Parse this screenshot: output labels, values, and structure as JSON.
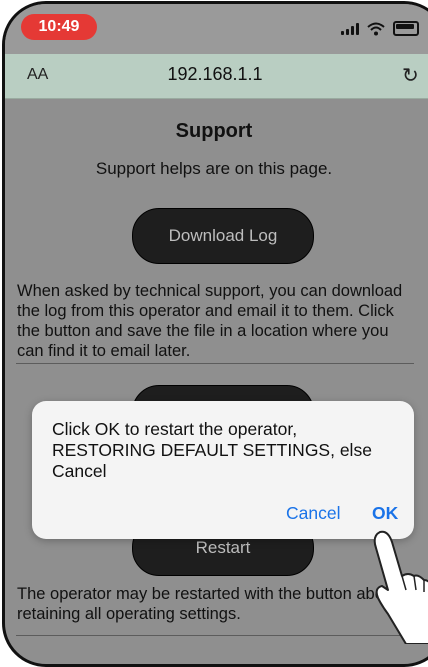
{
  "status_bar": {
    "time": "10:49",
    "signal_icon": "signal-icon",
    "wifi_icon": "wifi-icon",
    "battery_icon": "battery-icon"
  },
  "address_bar": {
    "text_size_label": "AA",
    "url": "192.168.1.1",
    "reload_icon": "reload-icon"
  },
  "page": {
    "title": "Support",
    "subtitle": "Support helps are on this page.",
    "download_button": "Download Log",
    "download_text": "When asked by technical support, you can download the log from this operator and email it to them. Click the button and save the file in a location where you can find it to email later.",
    "restart_button": "Restart",
    "restart_text": "The operator may be restarted with the button above, retaining all operating settings."
  },
  "dialog": {
    "message": "Click OK to restart the operator, RESTORING DEFAULT SETTINGS, else Cancel",
    "cancel_label": "Cancel",
    "ok_label": "OK"
  },
  "colors": {
    "time_pill": "#e53935",
    "address_bar": "#b9cec2",
    "link_blue": "#1a73e8",
    "overlay": "#8f8f8f"
  }
}
